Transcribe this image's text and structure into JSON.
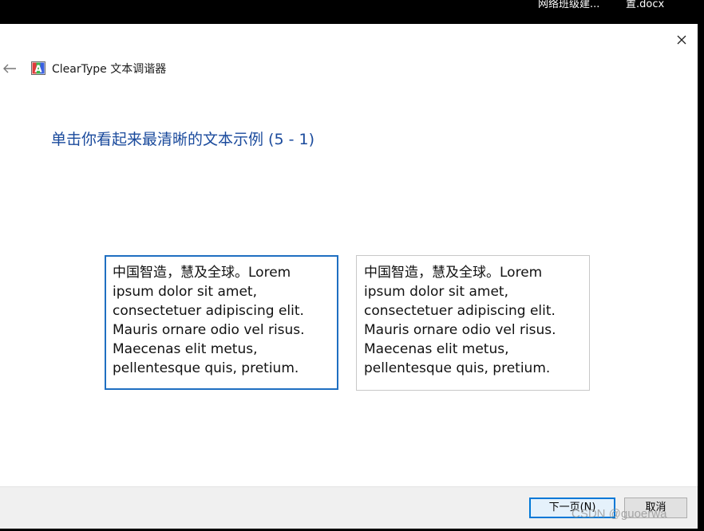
{
  "taskbar": {
    "items": [
      "网络班级建...",
      "置.docx"
    ]
  },
  "window": {
    "app_title": "ClearType 文本调谐器",
    "heading": "单击你看起来最清晰的文本示例 (5 - 1)",
    "samples": [
      {
        "lines": [
          "中国智造，慧及全球。Lorem",
          "ipsum dolor sit amet,",
          "consectetuer adipiscing elit.",
          "Mauris ornare odio vel risus.",
          "Maecenas elit metus,",
          "pellentesque quis, pretium."
        ],
        "selected": true
      },
      {
        "lines": [
          "中国智造，慧及全球。Lorem",
          "ipsum dolor sit amet,",
          "consectetuer adipiscing elit.",
          "Mauris ornare odio vel risus.",
          "Maecenas elit metus,",
          "pellentesque quis, pretium."
        ],
        "selected": false
      }
    ],
    "buttons": {
      "next": "下一页(N)",
      "cancel": "取消"
    }
  },
  "watermark": "CSDN @guoerwa",
  "icons": {
    "back": "back-arrow-icon",
    "close": "close-icon",
    "app": "cleartype-app-icon"
  },
  "colors": {
    "heading": "#1a4a9c",
    "selected_border": "#1f6fc1",
    "button_focus": "#0078d7"
  }
}
